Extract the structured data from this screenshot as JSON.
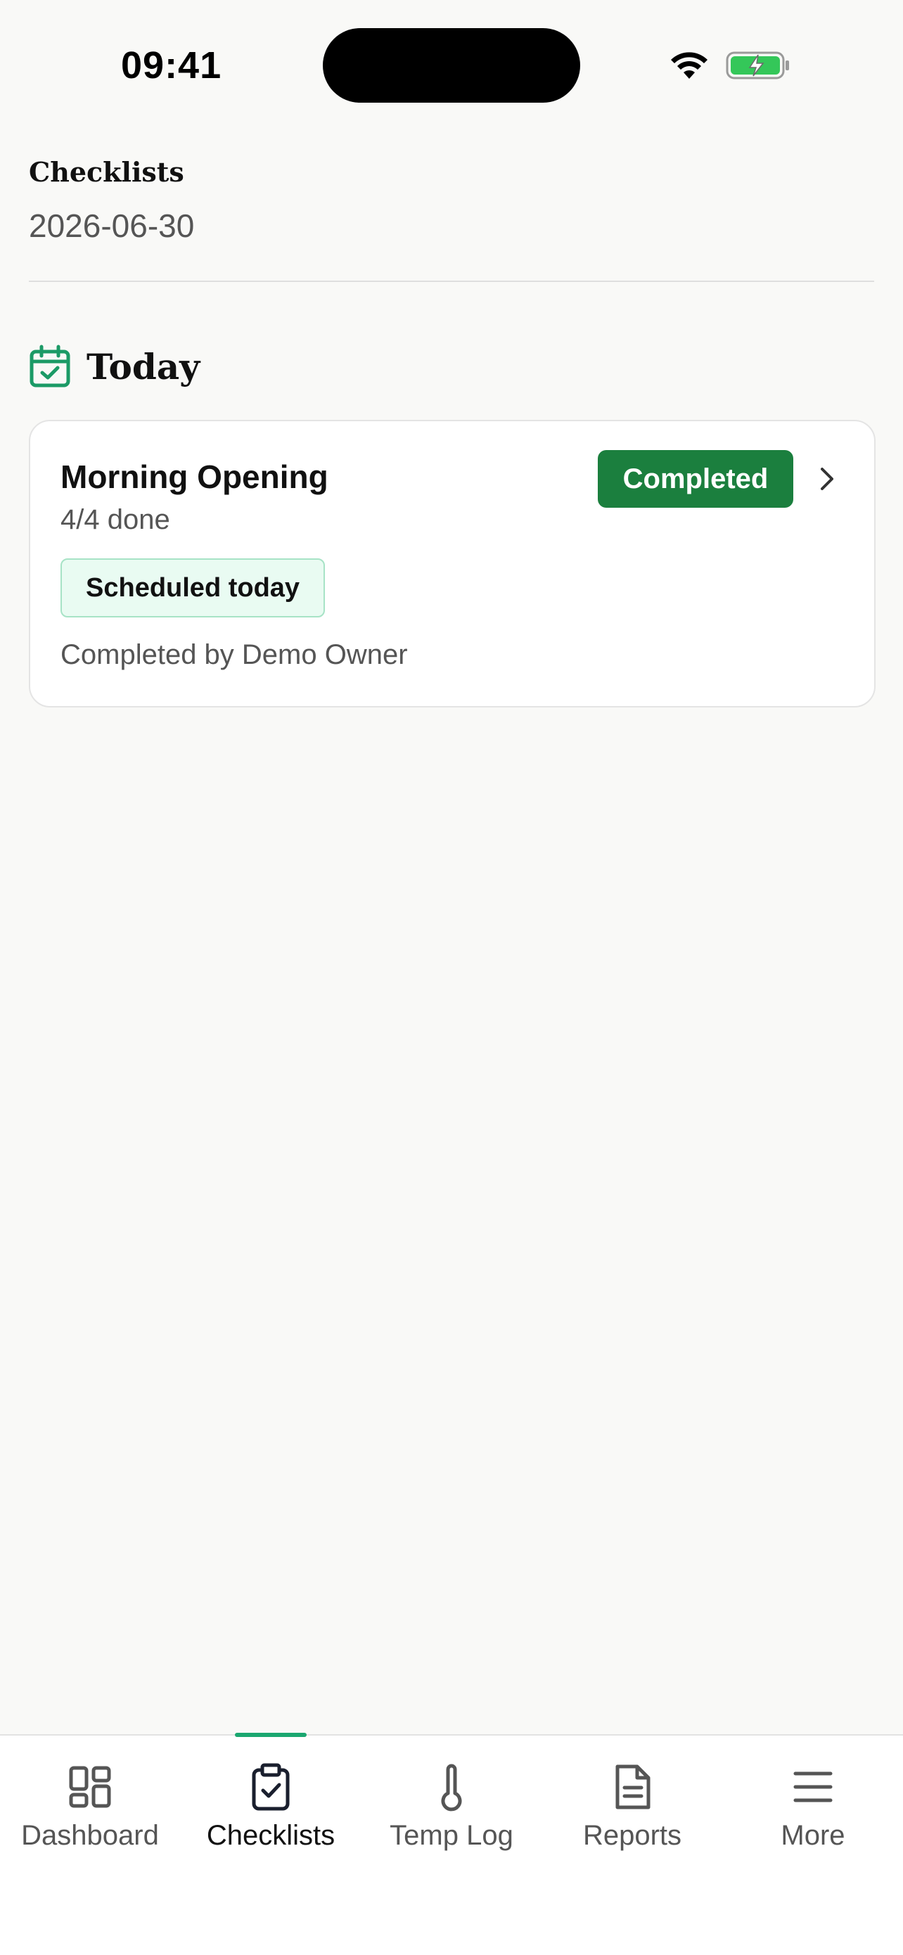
{
  "status_bar": {
    "time": "09:41"
  },
  "header": {
    "title": "Checklists",
    "date": "2026-06-30"
  },
  "section": {
    "title": "Today",
    "icon": "calendar-check-icon"
  },
  "checklist_card": {
    "title": "Morning Opening",
    "progress": "4/4 done",
    "schedule_badge": "Scheduled today",
    "completed_by": "Completed by Demo Owner",
    "status": "Completed"
  },
  "tabs": [
    {
      "label": "Dashboard",
      "icon": "dashboard-grid-icon",
      "active": false
    },
    {
      "label": "Checklists",
      "icon": "clipboard-check-icon",
      "active": true
    },
    {
      "label": "Temp Log",
      "icon": "thermometer-icon",
      "active": false
    },
    {
      "label": "Reports",
      "icon": "document-icon",
      "active": false
    },
    {
      "label": "More",
      "icon": "menu-icon",
      "active": false
    }
  ],
  "colors": {
    "background": "#f9f9f7",
    "accent": "#1ba770",
    "status_completed": "#1b7f3e",
    "badge_bg": "#e9fbf2",
    "badge_border": "#a7e3c6",
    "muted_text": "#555555"
  }
}
